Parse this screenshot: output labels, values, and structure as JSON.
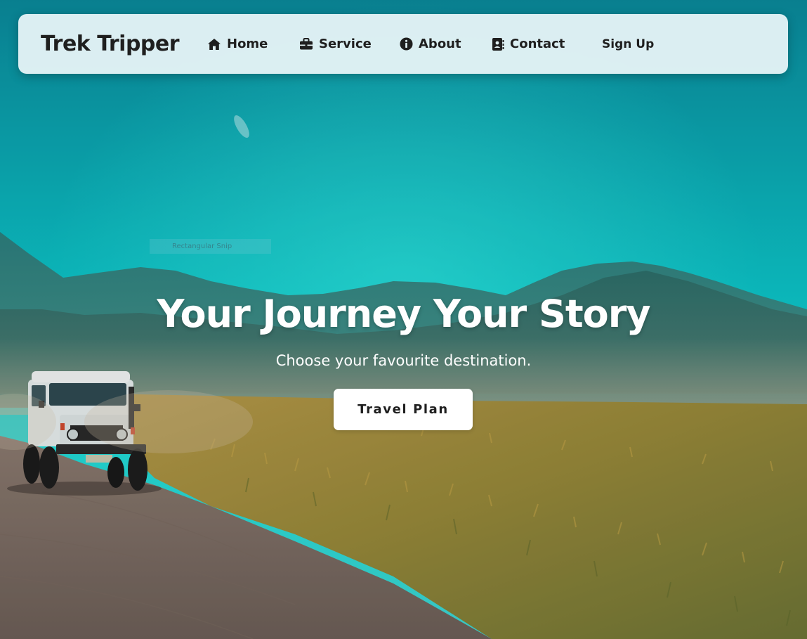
{
  "brand": "Trek Tripper",
  "nav": {
    "home": {
      "label": "Home",
      "icon": "home-icon"
    },
    "service": {
      "label": "Service",
      "icon": "briefcase-icon"
    },
    "about": {
      "label": "About",
      "icon": "info-icon"
    },
    "contact": {
      "label": "Contact",
      "icon": "address-book-icon"
    },
    "signup": {
      "label": "Sign Up"
    }
  },
  "hero": {
    "title": "Your Journey Your Story",
    "subtitle": "Choose your favourite destination.",
    "cta_label": "Travel Plan"
  },
  "overlay": {
    "snip_label": "Rectangular Snip"
  },
  "colors": {
    "sky_top": "#0a8fa0",
    "sky_bottom": "#1fd8d8",
    "nav_bg": "#e4f3f6",
    "text_dark": "#1f1f1f",
    "button_bg": "#ffffff"
  }
}
